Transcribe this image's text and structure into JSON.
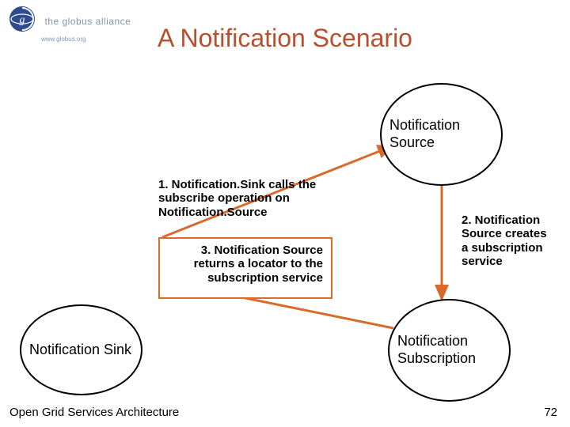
{
  "logo": {
    "brand": "the globus alliance",
    "url": "www.globus.org"
  },
  "title": "A Notification Scenario",
  "nodes": {
    "source": "Notification Source",
    "sink": "Notification Sink",
    "subscription": "Notification Subscription"
  },
  "steps": {
    "s1": "1. Notification.Sink calls the subscribe operation on Notification.Source",
    "s2": "2. Notification Source creates a subscription service",
    "s3": "3. Notification Source returns a locator to the subscription service"
  },
  "footer": {
    "org": "Open Grid Services Architecture",
    "page": "72"
  },
  "colors": {
    "accent": "#b94f2f",
    "arrow": "#d86a2b"
  }
}
